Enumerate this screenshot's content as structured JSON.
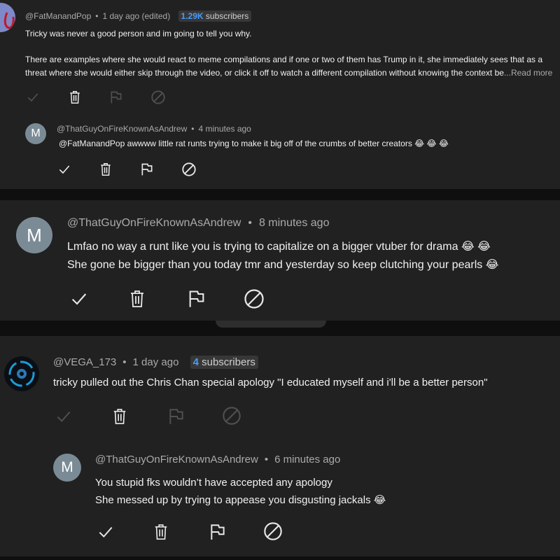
{
  "comments": [
    {
      "author": "@FatManandPop",
      "time": "1 day ago (edited)",
      "subscriber_count": "1.29K",
      "subscriber_suffix": " subscribers",
      "lines": [
        "Tricky was never a good person and im going to tell you why.",
        "",
        "There are examples where she would react to meme compilations and if one or two of them has Trump in it, she immediately sees that as a",
        "threat where she would either skip through the video, or click it off to watch a different compilation without knowing the context be"
      ],
      "read_more": "...Read more",
      "reply": {
        "avatar_letter": "M",
        "author": "@ThatGuyOnFireKnownAsAndrew",
        "time": "4 minutes ago",
        "lines": [
          "@FatManandPop awwww little rat runts trying to make it big off of the crumbs of better creators 😂 😂 😂"
        ]
      }
    },
    {
      "avatar_letter": "M",
      "author": "@ThatGuyOnFireKnownAsAndrew",
      "time": "8 minutes ago",
      "lines": [
        "Lmfao no way a runt like you is trying to capitalize on a bigger vtuber for drama 😂 😂",
        "She gone be bigger than you today tmr and yesterday so keep clutching your pearls 😂"
      ]
    },
    {
      "author": "@VEGA_173",
      "time": "1 day ago",
      "subscriber_count": "4",
      "subscriber_suffix": " subscribers",
      "lines": [
        "tricky pulled out the Chris Chan special apology \"I educated myself and i'll be a better person\""
      ],
      "reply": {
        "avatar_letter": "M",
        "author": "@ThatGuyOnFireKnownAsAndrew",
        "time": "6 minutes ago",
        "lines": [
          "You stupid fks wouldn’t have accepted any apology",
          "She messed up by trying to appease you disgusting jackals 😂"
        ]
      }
    }
  ],
  "icons": [
    "approve-check-icon",
    "delete-trash-icon",
    "report-flag-icon",
    "block-user-icon"
  ],
  "colors": {
    "background": "#212121",
    "separator": "#0f0f0f",
    "subscriber_accent": "#4a9cf7",
    "meta_text": "#aaaaaa"
  }
}
